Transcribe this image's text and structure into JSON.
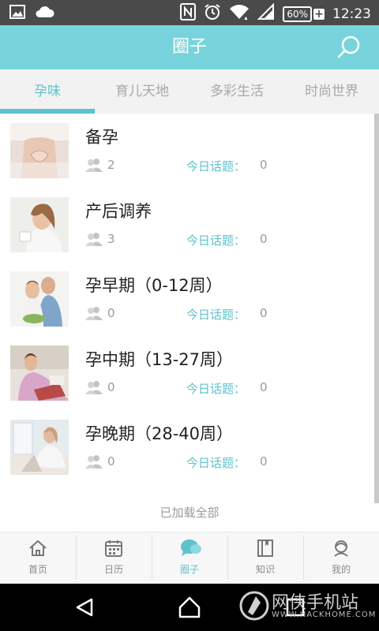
{
  "status_bar": {
    "time": "12:23",
    "battery": "60%",
    "icons": [
      "image-icon",
      "cloud-icon",
      "nfc-icon",
      "alarm-icon",
      "wifi-icon",
      "signal-icon",
      "battery-charging-icon"
    ]
  },
  "header": {
    "title": "圈子",
    "search_icon": "search-icon"
  },
  "tabs": [
    {
      "label": "孕味",
      "active": true
    },
    {
      "label": "育儿天地",
      "active": false
    },
    {
      "label": "多彩生活",
      "active": false
    },
    {
      "label": "时尚世界",
      "active": false
    }
  ],
  "groups": [
    {
      "name": "备孕",
      "members": "2",
      "topics_label": "今日话题：",
      "topics": "0"
    },
    {
      "name": "产后调养",
      "members": "3",
      "topics_label": "今日话题：",
      "topics": "0"
    },
    {
      "name": "孕早期（0-12周）",
      "members": "0",
      "topics_label": "今日话题：",
      "topics": "0"
    },
    {
      "name": "孕中期（13-27周）",
      "members": "0",
      "topics_label": "今日话题：",
      "topics": "0"
    },
    {
      "name": "孕晚期（28-40周）",
      "members": "0",
      "topics_label": "今日话题：",
      "topics": "0"
    }
  ],
  "footer_text": "已加载全部",
  "bottom_nav": [
    {
      "label": "首页",
      "icon": "home-icon",
      "active": false
    },
    {
      "label": "日历",
      "icon": "calendar-icon",
      "active": false
    },
    {
      "label": "圈子",
      "icon": "chat-bubbles-icon",
      "active": true
    },
    {
      "label": "知识",
      "icon": "book-icon",
      "active": false
    },
    {
      "label": "我的",
      "icon": "profile-icon",
      "active": false
    }
  ],
  "watermark": {
    "title": "网侠手机站",
    "url": "WWW.HACKHOME.COM"
  },
  "colors": {
    "accent": "#78d4dc",
    "accent_text": "#5dc2cc",
    "status_bar": "#4a4a4a"
  }
}
